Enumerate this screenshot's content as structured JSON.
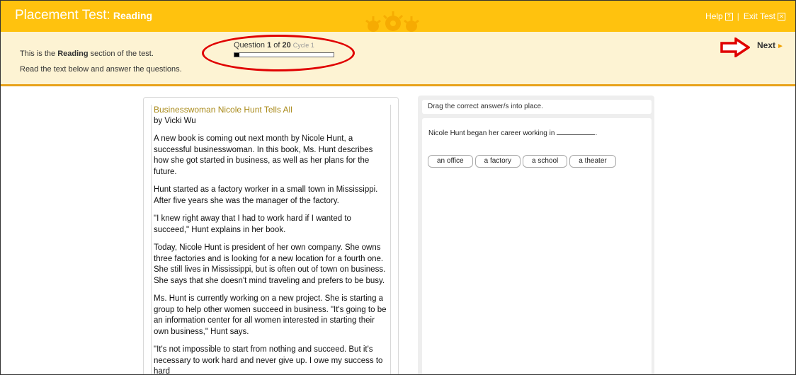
{
  "header": {
    "title": "Placement Test:",
    "section": "Reading",
    "help": "Help",
    "help_icon": "?",
    "separator": "|",
    "exit": "Exit Test",
    "exit_icon": "✕"
  },
  "info": {
    "line1_pre": "This is the ",
    "line1_bold": "Reading",
    "line1_post": " section of the test.",
    "line2": "Read the text below and answer the questions.",
    "question_pre": "Question ",
    "question_current": "1",
    "question_of": " of ",
    "question_total": "20",
    "cycle": "Cycle 1",
    "progress_fraction": 0.05,
    "next_label": "Next",
    "next_icon": "►"
  },
  "passage": {
    "title": "Businesswoman Nicole Hunt Tells All",
    "author": "by Vicki Wu",
    "paragraphs": [
      "A new book is coming out next month by Nicole Hunt, a successful businesswoman. In this book, Ms. Hunt describes how she got started in business, as well as her plans for the future.",
      "Hunt started as a factory worker in a small town in Mississippi. After five years she was the manager of the factory.",
      "\"I knew right away that I had to work hard if I wanted to succeed,\" Hunt explains in her book.",
      "Today, Nicole Hunt is president of her own company. She owns three factories and is looking for a new location for a fourth one. She still lives in Mississippi, but is often out of town on business. She says that she doesn't mind traveling and prefers to be busy.",
      "Ms. Hunt is currently working on a new project. She is starting a group to help other women succeed in business. \"It's going to be an information center for all women interested in starting their own business,\" Hunt says.",
      "\"It's not impossible to start from nothing and succeed. But it's necessary to work hard and never give up. I owe my success to hard"
    ]
  },
  "question": {
    "instruction": "Drag the correct answer/s into place.",
    "stem_pre": "Nicole Hunt began her career working in",
    "stem_post": ".",
    "options": [
      "an office",
      "a factory",
      "a school",
      "a theater"
    ]
  },
  "colors": {
    "header_bg": "#ffc20e",
    "info_bg": "#fdf3d3",
    "accent_border": "#e8a21a",
    "annotation_red": "#e00000",
    "title_gold": "#a98a1a"
  }
}
